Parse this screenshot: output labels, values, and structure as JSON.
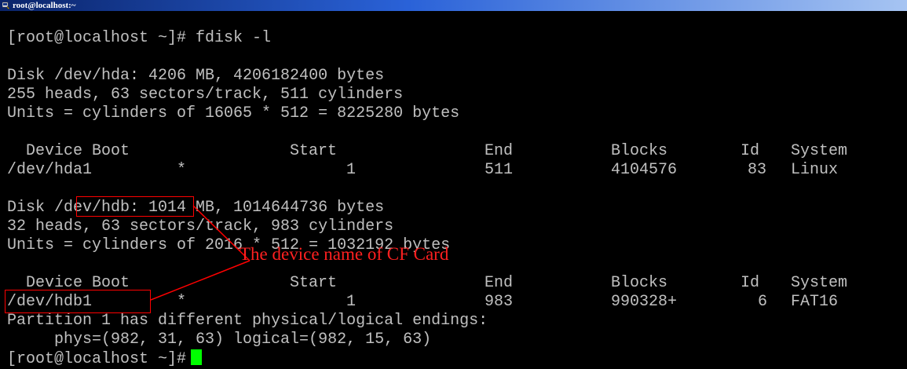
{
  "window": {
    "title": "root@localhost:~",
    "icon": "putty-terminal-icon"
  },
  "terminal": {
    "prompt_cmd": "[root@localhost ~]# fdisk -l",
    "disk1": {
      "summary": "Disk /dev/hda: 4206 MB, 4206182400 bytes",
      "geometry": "255 heads, 63 sectors/track, 511 cylinders",
      "units": "Units = cylinders of 16065 * 512 = 8225280 bytes"
    },
    "table_headers": [
      "Device Boot",
      "Start",
      "End",
      "Blocks",
      "Id",
      "System"
    ],
    "disk1_partitions": [
      {
        "device": "/dev/hda1",
        "boot": "*",
        "start": "1",
        "end": "511",
        "blocks": "4104576",
        "id": "83",
        "system": "Linux"
      }
    ],
    "disk2": {
      "prefix": "Disk ",
      "device": "/dev/hdb",
      "rest": ": 1014 MB, 1014644736 bytes",
      "geometry": "32 heads, 63 sectors/track, 983 cylinders",
      "units": "Units = cylinders of 2016 * 512 = 1032192 bytes"
    },
    "disk2_partitions": [
      {
        "device": "/dev/hdb1",
        "boot": "*",
        "start": "1",
        "end": "983",
        "blocks": "990328+",
        "id": "6",
        "system": "FAT16"
      }
    ],
    "warning": "Partition 1 has different physical/logical endings:",
    "phys_logical": "     phys=(982, 31, 63) logical=(982, 15, 63)",
    "final_prompt": "[root@localhost ~]#"
  },
  "annotation": {
    "text": "The device name of CF Card",
    "color": "#ff0000"
  },
  "colors": {
    "text": "#c0c0c0",
    "background": "#000000",
    "cursor": "#00ff00"
  }
}
